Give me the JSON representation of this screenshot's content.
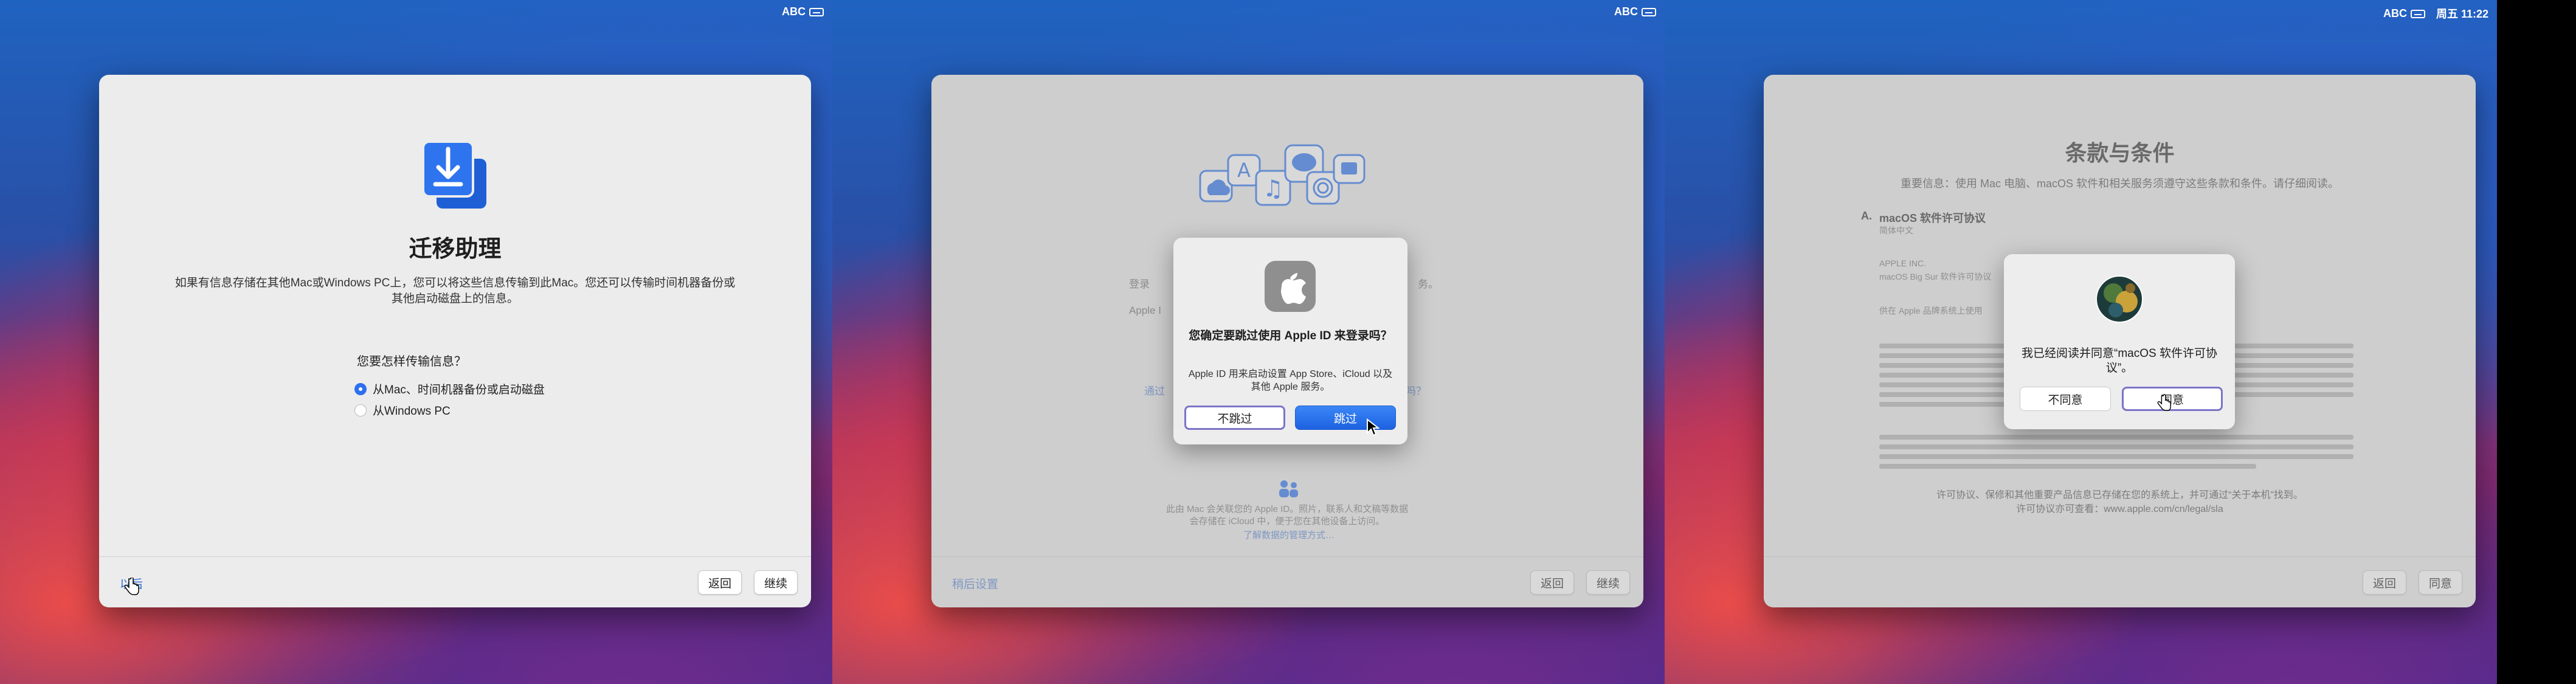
{
  "menubar": {
    "s1": {
      "input": "ABC"
    },
    "s2": {
      "input": "ABC"
    },
    "s3": {
      "input": "ABC",
      "clock": "周五 11:22"
    }
  },
  "screen1": {
    "title": "迁移助理",
    "description": "如果有信息存储在其他Mac或Windows PC上，您可以将这些信息传输到此Mac。您还可以传输时间机器备份或其他启动磁盘上的信息。",
    "question": "您要怎样传输信息？",
    "options": [
      "从Mac、时间机器备份或启动磁盘",
      "从Windows PC"
    ],
    "selected_index": 0,
    "footer": {
      "left_link": "以后",
      "back": "返回",
      "continue": "继续"
    }
  },
  "screen2": {
    "bg": {
      "line1_left": "登录",
      "line1_right": "务。",
      "line2_left": "Apple I",
      "link_left": "通过",
      "link_right": "吗？",
      "privacy_text": "此由 Mac 会关联您的 Apple ID。照片，联系人和文稿等数据会存储在 iCloud 中，便于您在其他设备上访问。",
      "privacy_link": "了解数据的管理方式…"
    },
    "dialog": {
      "title": "您确定要跳过使用 Apple ID 来登录吗？",
      "body": "Apple ID 用来启动设置 App Store、iCloud 以及其他 Apple 服务。",
      "cancel": "不跳过",
      "confirm": "跳过"
    },
    "footer": {
      "left_link": "稍后设置",
      "back": "返回",
      "continue": "继续"
    }
  },
  "screen3": {
    "title": "条款与条件",
    "subtitle": "重要信息：使用 Mac 电脑、macOS 软件和相关服务须遵守这些条款和条件。请仔细阅读。",
    "section_label": "A.",
    "section_title": "macOS 软件许可协议",
    "section_sub": "简体中文",
    "company": "APPLE INC.",
    "license_name": "macOS Big Sur 软件许可协议",
    "body_prefix": "供在 Apple 品牌系统上使用",
    "footer_note": "许可协议、保修和其他重要产品信息已存储在您的系统上，并可通过“关于本机”找到。",
    "footer_url_line": "许可协议亦可查看：www.apple.com/cn/legal/sla",
    "dialog": {
      "title": "我已经阅读并同意“macOS 软件许可协议”。",
      "disagree": "不同意",
      "agree": "同意"
    },
    "footer": {
      "back": "返回",
      "agree": "同意"
    }
  },
  "colors": {
    "accent": "#2d6ff0",
    "window_bg": "#ececec",
    "focus_ring": "#7b74c9"
  }
}
